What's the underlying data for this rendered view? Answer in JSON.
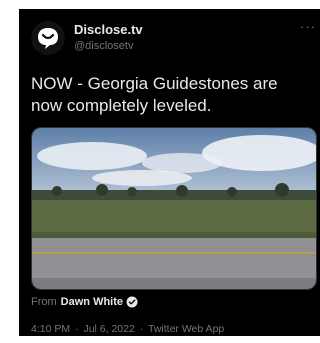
{
  "account": {
    "display_name": "Disclose.tv",
    "handle": "@disclosetv",
    "avatar_icon": "disclose-logo-icon"
  },
  "more_label": "···",
  "tweet": {
    "text": "NOW - Georgia Guidestones are now completely leveled."
  },
  "media": {
    "description_icon": "video-thumbnail"
  },
  "attribution": {
    "prefix": "From",
    "source": "Dawn White"
  },
  "meta": {
    "time": "4:10 PM",
    "separator_1": "·",
    "date": "Jul 6, 2022",
    "separator_2": "·",
    "app": "Twitter Web App"
  },
  "colors": {
    "background": "#000000",
    "text": "#e7e9ea",
    "muted": "#71767b",
    "verified": "#e7e9ea"
  }
}
